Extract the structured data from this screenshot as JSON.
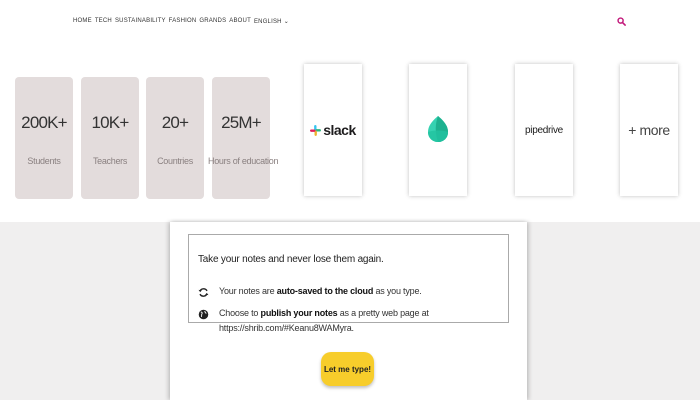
{
  "nav": {
    "items": [
      "HOME",
      "TECH",
      "SUSTAINABILITY",
      "FASHION",
      "GRANDS",
      "ABOUT",
      "ENGLISH"
    ],
    "search_icon": "search-icon",
    "search_color": "#c2187a"
  },
  "stats": [
    {
      "value": "200K+",
      "label": "Students"
    },
    {
      "value": "10K+",
      "label": "Teachers"
    },
    {
      "value": "20+",
      "label": "Countries"
    },
    {
      "value": "25M+",
      "label": "Hours of education"
    }
  ],
  "logos": {
    "slack": "slack",
    "pipedrive": "pipedrive",
    "more": "+ more"
  },
  "notes": {
    "intro": "Take your notes and never lose them again.",
    "feature1_pre": "Your notes are ",
    "feature1_bold": "auto-saved to the cloud",
    "feature1_post": " as you type.",
    "feature2_pre": "Choose to ",
    "feature2_bold": "publish your notes",
    "feature2_post": " as a pretty web page at",
    "url": "https://shrib.com/#Keanu8WAMyra.",
    "button": "Let me type!"
  },
  "colors": {
    "accent_button": "#f7cd2b",
    "stat_card": "#e3dcdc",
    "background": "#f0efef"
  }
}
